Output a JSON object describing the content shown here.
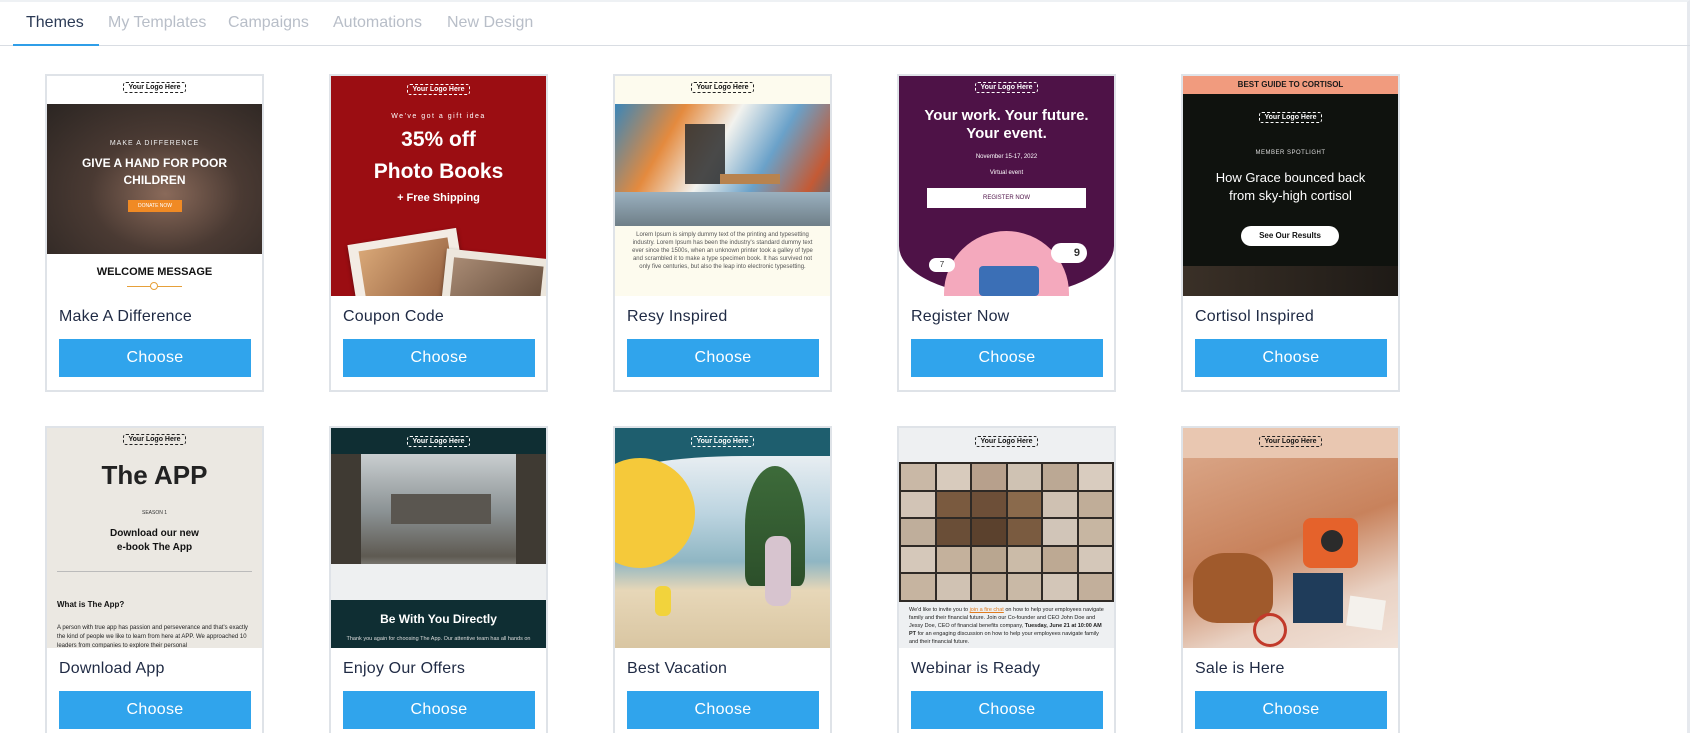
{
  "tabs": [
    {
      "label": "Themes",
      "active": true
    },
    {
      "label": "My Templates",
      "active": false
    },
    {
      "label": "Campaigns",
      "active": false
    },
    {
      "label": "Automations",
      "active": false
    },
    {
      "label": "New Design",
      "active": false
    }
  ],
  "choose_label": "Choose",
  "logo_text": "Your Logo Here",
  "cards": [
    {
      "title": "Make A Difference",
      "thumb": {
        "kicker": "MAKE A DIFFERENCE",
        "headline_1": "GIVE A HAND FOR POOR",
        "headline_2": "CHILDREN",
        "cta": "DONATE NOW",
        "footer": "WELCOME MESSAGE"
      }
    },
    {
      "title": "Coupon Code",
      "thumb": {
        "kicker": "We've got a gift idea",
        "headline_1": "35% off",
        "headline_2": "Photo Books",
        "sub": "+ Free Shipping"
      }
    },
    {
      "title": "Resy Inspired",
      "thumb": {
        "body": "Lorem Ipsum is simply dummy text of the printing and typesetting industry. Lorem Ipsum has been the industry's standard dummy text ever since the 1500s, when an unknown printer took a galley of type and scrambled it to make a type specimen book. It has survived not only five centuries, but also the leap into electronic typesetting."
      }
    },
    {
      "title": "Register Now",
      "thumb": {
        "headline_1": "Your work. Your future.",
        "headline_2": "Your event.",
        "date": "November 15-17, 2022",
        "mode": "Virtual event",
        "cta": "REGISTER NOW",
        "badge_left": "7",
        "badge_right": "9"
      }
    },
    {
      "title": "Cortisol Inspired",
      "thumb": {
        "banner": "BEST GUIDE TO CORTISOL",
        "kicker": "MEMBER SPOTLIGHT",
        "headline_1": "How Grace bounced back",
        "headline_2": "from sky-high cortisol",
        "cta": "See Our Results"
      }
    },
    {
      "title": "Download App",
      "thumb": {
        "headline": "The APP",
        "kicker": "SEASON 1",
        "sub_1": "Download our new",
        "sub_2": "e-book The App",
        "section": "What is The App?",
        "body": "A person with true app has passion and perseverance and that's exactly the kind of people we like to learn from here at APP. We approached 10 leaders from companies to explore their personal"
      }
    },
    {
      "title": "Enjoy Our Offers",
      "thumb": {
        "headline": "Be With You Directly",
        "body": "Thank you again for choosing The App. Our attentive team has all hands on"
      }
    },
    {
      "title": "Best Vacation",
      "thumb": {}
    },
    {
      "title": "Webinar is Ready",
      "thumb": {
        "body_1": "We'd like to invite you to",
        "link": "join a fire chat",
        "body_2": "on how to help your employees navigate family and their financial future. Join our Co-founder and CEO John Doe and Jessy Doe, CEO of financial benefits company,",
        "bold": "Tuesday, June 21 at 10:00 AM PT",
        "body_3": "for an engaging discussion on how to help your employees navigate family and their financial future."
      }
    },
    {
      "title": "Sale is Here",
      "thumb": {}
    }
  ],
  "colors": {
    "accent": "#30a4ec",
    "tab_active": "#2b3a55",
    "tab_inactive": "#b8bec8"
  }
}
